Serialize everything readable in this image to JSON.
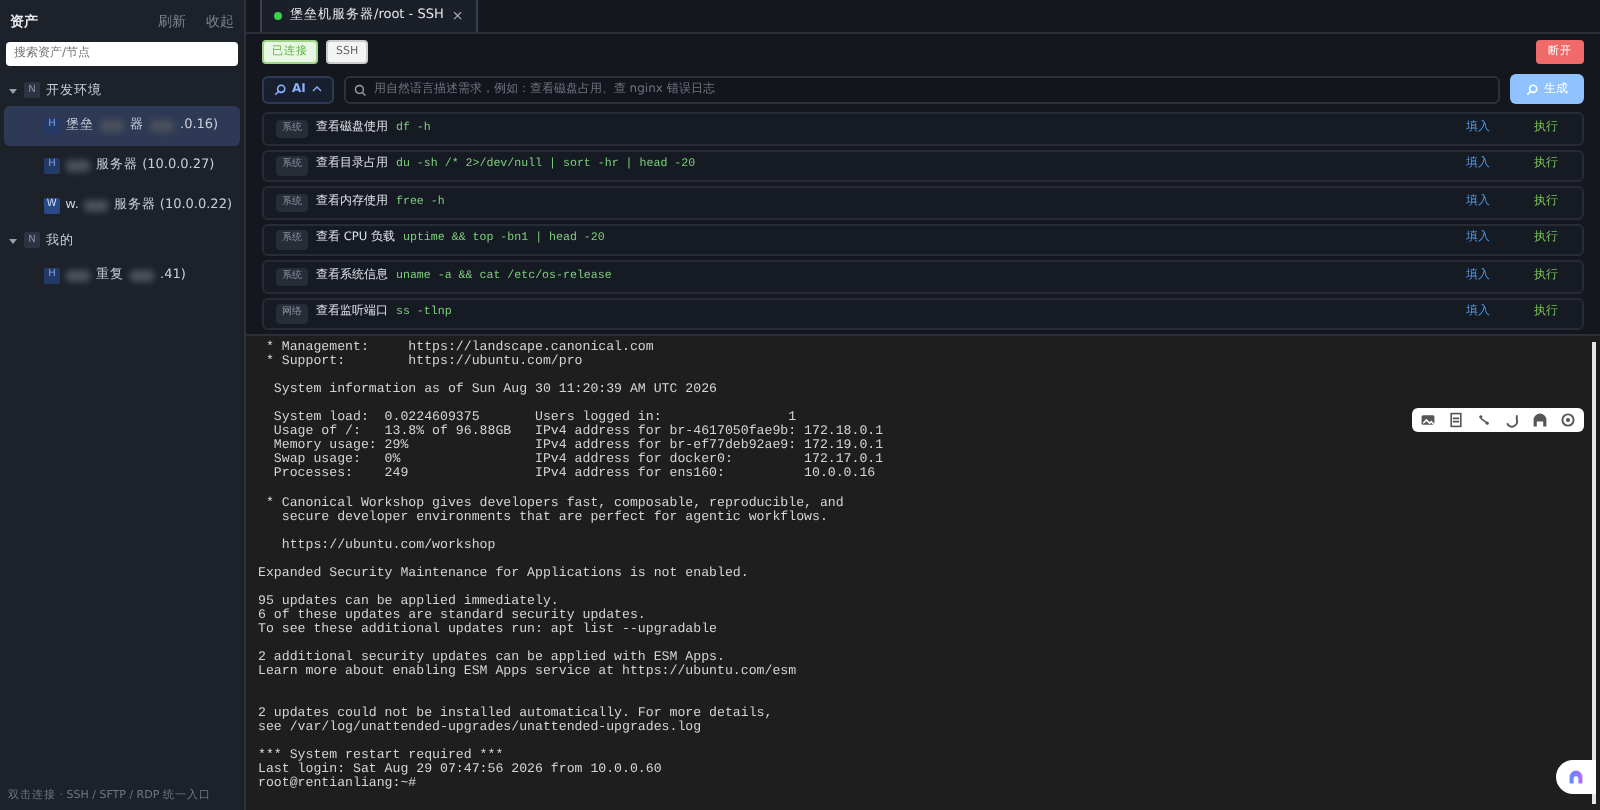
{
  "sidebar": {
    "title": "资产",
    "actions": [
      "刷新",
      "收起"
    ],
    "search": {
      "placeholder": "搜索资产/节点"
    },
    "tree": [
      {
        "badge": "N",
        "label": "开发环境",
        "expanded": true,
        "children": [
          {
            "badge": "H",
            "segments": [
              {
                "kind": "text",
                "text": "堡垒"
              },
              {
                "kind": "blur"
              },
              {
                "kind": "text",
                "text": "器"
              },
              {
                "kind": "blur"
              },
              {
                "kind": "text",
                "text": ".0.16)"
              }
            ],
            "selected": true
          },
          {
            "badge": "H",
            "segments": [
              {
                "kind": "blur"
              },
              {
                "kind": "text",
                "text": "服务器 (10.0.0.27)"
              }
            ],
            "selected": false
          },
          {
            "badge": "W",
            "segments": [
              {
                "kind": "text",
                "text": "w."
              },
              {
                "kind": "blur"
              },
              {
                "kind": "text",
                "text": "服务器 (10.0.0.22)"
              }
            ],
            "selected": false
          }
        ]
      },
      {
        "badge": "N",
        "label": "我的",
        "expanded": true,
        "children": [
          {
            "badge": "H",
            "segments": [
              {
                "kind": "blur"
              },
              {
                "kind": "text",
                "text": "重复"
              },
              {
                "kind": "blur"
              },
              {
                "kind": "text",
                "text": ".41)"
              }
            ],
            "selected": false
          }
        ]
      }
    ],
    "footer": "双击连接 · SSH / SFTP / RDP 统一入口"
  },
  "tabs": [
    {
      "label": "堡垒机服务器/root - SSH",
      "close": "×",
      "online": true,
      "selected": true
    }
  ],
  "status": {
    "tags": [
      {
        "label": "已连接",
        "kind": "success"
      },
      {
        "label": "SSH",
        "kind": "plain"
      }
    ],
    "disconnect": "断开"
  },
  "ai": {
    "mode": "AI",
    "placeholder": "用自然语言描述需求，例如：查看磁盘占用、查 nginx 错误日志",
    "generate": "生成"
  },
  "commands": [
    {
      "tag": "系统",
      "title": "查看磁盘使用",
      "cmd": "df -h",
      "fill": "填入",
      "run": "执行"
    },
    {
      "tag": "系统",
      "title": "查看目录占用",
      "cmd": "du -sh /* 2>/dev/null | sort -hr | head -20",
      "fill": "填入",
      "run": "执行"
    },
    {
      "tag": "系统",
      "title": "查看内存使用",
      "cmd": "free -h",
      "fill": "填入",
      "run": "执行"
    },
    {
      "tag": "系统",
      "title": "查看 CPU 负载",
      "cmd": "uptime && top -bn1 | head -20",
      "fill": "填入",
      "run": "执行"
    },
    {
      "tag": "系统",
      "title": "查看系统信息",
      "cmd": "uname -a && cat /etc/os-release",
      "fill": "填入",
      "run": "执行"
    },
    {
      "tag": "网络",
      "title": "查看监听端口",
      "cmd": "ss -tlnp",
      "fill": "填入",
      "run": "执行"
    }
  ],
  "terminal": {
    "blocks": [
      {
        "lines": [
          " * Management:     https://landscape.canonical.com",
          " * Support:        https://ubuntu.com/pro"
        ]
      },
      {
        "lines": [
          "  System information as of Sun Aug 30 11:20:39 AM UTC 2026"
        ]
      },
      {
        "lines": [
          "  System load:  0.0224609375       Users logged in:                1",
          "  Usage of /:   13.8% of 96.88GB   IPv4 address for br-4617050fae9b: 172.18.0.1",
          "  Memory usage: 29%                IPv4 address for br-ef77deb92ae9: 172.19.0.1",
          "  Swap usage:   0%                 IPv4 address for docker0:         172.17.0.1",
          "  Processes:    249                IPv4 address for ens160:          10.0.0.16"
        ]
      },
      {
        "lines": [
          " * Canonical Workshop gives developers fast, composable, reproducible, and",
          "   secure developer environments that are perfect for agentic workflows."
        ]
      },
      {
        "lines": [
          "   https://ubuntu.com/workshop"
        ]
      },
      {
        "lines": [
          "Expanded Security Maintenance for Applications is not enabled."
        ]
      },
      {
        "lines": [
          "95 updates can be applied immediately.",
          "6 of these updates are standard security updates.",
          "To see these additional updates run: apt list --upgradable"
        ]
      },
      {
        "lines": [
          "2 additional security updates can be applied with ESM Apps.",
          "Learn more about enabling ESM Apps service at https://ubuntu.com/esm"
        ]
      },
      {
        "lines": [
          "2 updates could not be installed automatically. For more details,",
          "see /var/log/unattended-upgrades/unattended-upgrades.log"
        ],
        "wide_gap": true
      },
      {
        "lines": [
          "*** System restart required ***",
          "Last login: Sat Aug 29 07:47:56 2026 from 10.0.0.60",
          "root@rentianliang:~#"
        ]
      }
    ]
  }
}
